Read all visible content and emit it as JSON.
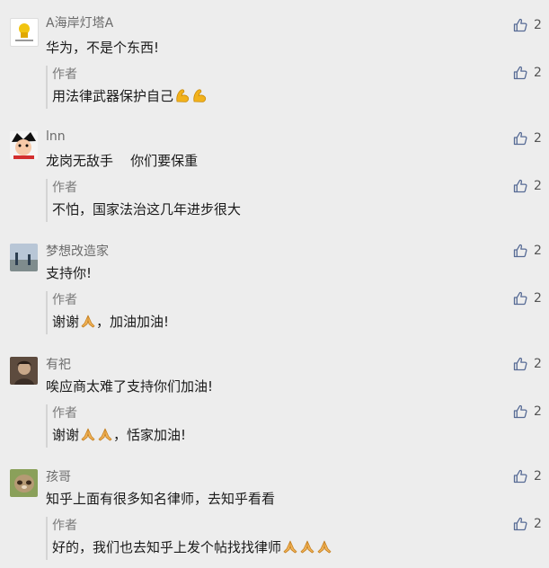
{
  "comments": [
    {
      "nickname": "A海岸灯塔A",
      "text": "华为，不是个东西!",
      "likes": "2",
      "avatar_icon": "lighthouse-avatar-icon",
      "reply": {
        "author": "作者",
        "text": "用法律武器保护自己",
        "likes": "2"
      }
    },
    {
      "nickname": "lnn",
      "text": "龙岗无敌手    你们要保重",
      "likes": "2",
      "avatar_icon": "cartoon-avatar-icon",
      "reply": {
        "author": "作者",
        "text": "不怕，国家法治这几年进步很大",
        "likes": "2"
      }
    },
    {
      "nickname": "梦想改造家",
      "text": "支持你!",
      "likes": "2",
      "avatar_icon": "landscape-avatar-icon",
      "reply": {
        "author": "作者",
        "text_before": "谢谢",
        "text_after": "，加油加油!",
        "likes": "2"
      }
    },
    {
      "nickname": "有祀",
      "text": "唉应商太难了支持你们加油!",
      "likes": "2",
      "avatar_icon": "photo-avatar-icon",
      "reply": {
        "author": "作者",
        "text_before": "谢谢",
        "text_after": "，恬家加油!",
        "likes": "2"
      }
    },
    {
      "nickname": "孩哥",
      "text": "知乎上面有很多知名律师，去知乎看看",
      "likes": "2",
      "avatar_icon": "sloth-avatar-icon",
      "reply": {
        "author": "作者",
        "text": "好的，我们也去知乎上发个帖找找律师",
        "likes": "2"
      }
    }
  ]
}
